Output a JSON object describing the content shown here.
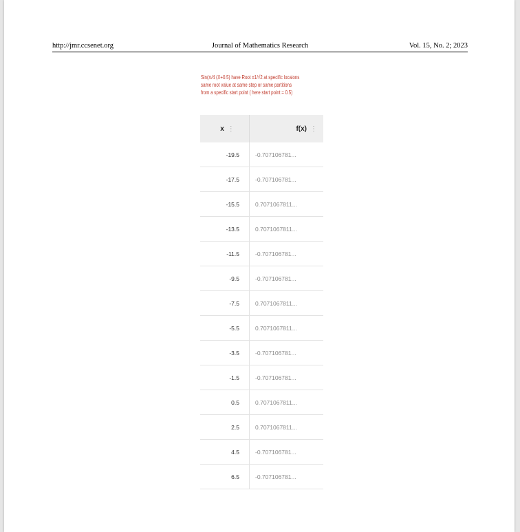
{
  "header": {
    "left": "http://jmr.ccsenet.org",
    "center": "Journal of Mathematics Research",
    "right": "Vol. 15, No. 2; 2023"
  },
  "figure": {
    "caption_lines": [
      "Sin(π/4 (X+0.5) have Root ±1/√2 at specific locaions",
      "same root value at same step or same partitions",
      "from a specific start point ( here start point = 0.5)"
    ],
    "table": {
      "headers": [
        "x",
        "f(x)"
      ],
      "menu_glyph": "⋮",
      "rows": [
        {
          "x": "-19.5",
          "f": "-0.707106781..."
        },
        {
          "x": "-17.5",
          "f": "-0.707106781..."
        },
        {
          "x": "-15.5",
          "f": "0.7071067811..."
        },
        {
          "x": "-13.5",
          "f": "0.7071067811..."
        },
        {
          "x": "-11.5",
          "f": "-0.707106781..."
        },
        {
          "x": "-9.5",
          "f": "-0.707106781..."
        },
        {
          "x": "-7.5",
          "f": "0.7071067811..."
        },
        {
          "x": "-5.5",
          "f": "0.7071067811..."
        },
        {
          "x": "-3.5",
          "f": "-0.707106781..."
        },
        {
          "x": "-1.5",
          "f": "-0.707106781..."
        },
        {
          "x": "0.5",
          "f": "0.7071067811..."
        },
        {
          "x": "2.5",
          "f": "0.7071067811..."
        },
        {
          "x": "4.5",
          "f": "-0.707106781..."
        },
        {
          "x": "6.5",
          "f": "-0.707106781..."
        }
      ]
    }
  }
}
